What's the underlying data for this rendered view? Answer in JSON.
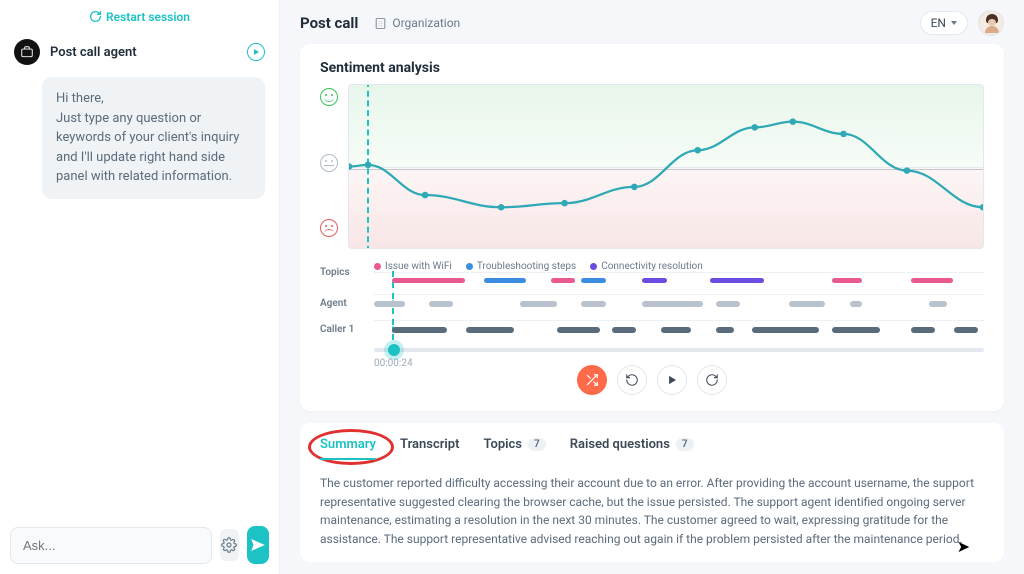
{
  "header": {
    "restart_label": "Restart session",
    "page_title": "Post call",
    "org_label": "Organization",
    "lang_label": "EN"
  },
  "agent": {
    "title": "Post call agent",
    "message_greeting": "Hi there,",
    "message_body": "Just type any question or keywords of your client's inquiry and I'll update right hand side panel with related information."
  },
  "composer": {
    "placeholder": "Ask..."
  },
  "sentiment": {
    "title": "Sentiment analysis",
    "playhead_time": "00:00:24"
  },
  "chart_data": {
    "type": "line",
    "title": "Sentiment analysis",
    "xlabel": "",
    "ylabel": "",
    "ylim": [
      -1,
      1
    ],
    "x": [
      0,
      0.03,
      0.12,
      0.24,
      0.34,
      0.45,
      0.55,
      0.64,
      0.7,
      0.78,
      0.88,
      1.0
    ],
    "series": [
      {
        "name": "Sentiment",
        "color": "#2ea9b5",
        "values": [
          0.0,
          0.02,
          -0.35,
          -0.5,
          -0.45,
          -0.25,
          0.2,
          0.48,
          0.55,
          0.4,
          -0.05,
          -0.5
        ]
      }
    ],
    "baseline": 0
  },
  "topics": {
    "label": "Topics",
    "legend": [
      {
        "label": "Issue with WiFi",
        "color": "#e85a8f"
      },
      {
        "label": "Troubleshooting steps",
        "color": "#3a8de0"
      },
      {
        "label": "Connectivity resolution",
        "color": "#6a4de0"
      }
    ],
    "segments": [
      {
        "start": 0.03,
        "end": 0.15,
        "color": "#e85a8f"
      },
      {
        "start": 0.18,
        "end": 0.25,
        "color": "#3a8de0"
      },
      {
        "start": 0.29,
        "end": 0.33,
        "color": "#e85a8f"
      },
      {
        "start": 0.34,
        "end": 0.38,
        "color": "#3a8de0"
      },
      {
        "start": 0.44,
        "end": 0.48,
        "color": "#6a4de0"
      },
      {
        "start": 0.55,
        "end": 0.64,
        "color": "#6a4de0"
      },
      {
        "start": 0.75,
        "end": 0.8,
        "color": "#e85a8f"
      },
      {
        "start": 0.88,
        "end": 0.95,
        "color": "#e85a8f"
      }
    ]
  },
  "tracks": {
    "agent": {
      "label": "Agent",
      "color": "#b8c2cd",
      "segments": [
        {
          "start": 0.0,
          "end": 0.05
        },
        {
          "start": 0.09,
          "end": 0.13
        },
        {
          "start": 0.24,
          "end": 0.3
        },
        {
          "start": 0.34,
          "end": 0.38
        },
        {
          "start": 0.44,
          "end": 0.54
        },
        {
          "start": 0.56,
          "end": 0.6
        },
        {
          "start": 0.68,
          "end": 0.74
        },
        {
          "start": 0.78,
          "end": 0.8
        },
        {
          "start": 0.91,
          "end": 0.94
        }
      ]
    },
    "caller": {
      "label": "Caller 1",
      "color": "#5a6b7b",
      "segments": [
        {
          "start": 0.03,
          "end": 0.12
        },
        {
          "start": 0.15,
          "end": 0.23
        },
        {
          "start": 0.3,
          "end": 0.37
        },
        {
          "start": 0.39,
          "end": 0.43
        },
        {
          "start": 0.47,
          "end": 0.52
        },
        {
          "start": 0.56,
          "end": 0.59
        },
        {
          "start": 0.62,
          "end": 0.73
        },
        {
          "start": 0.75,
          "end": 0.83
        },
        {
          "start": 0.88,
          "end": 0.92
        },
        {
          "start": 0.95,
          "end": 0.99
        }
      ]
    }
  },
  "tabs": {
    "items": [
      {
        "label": "Summary",
        "active": true
      },
      {
        "label": "Transcript",
        "active": false
      },
      {
        "label": "Topics",
        "badge": "7",
        "active": false
      },
      {
        "label": "Raised questions",
        "badge": "7",
        "active": false
      }
    ],
    "summary_text": "The customer reported difficulty accessing their account due to an error. After providing the account username, the support representative suggested clearing the browser cache, but the issue persisted. The support agent identified ongoing server maintenance, estimating a resolution in the next 30 minutes. The customer agreed to wait, expressing gratitude for the assistance. The support representative advised reaching out again if the problem persisted after the maintenance period."
  }
}
